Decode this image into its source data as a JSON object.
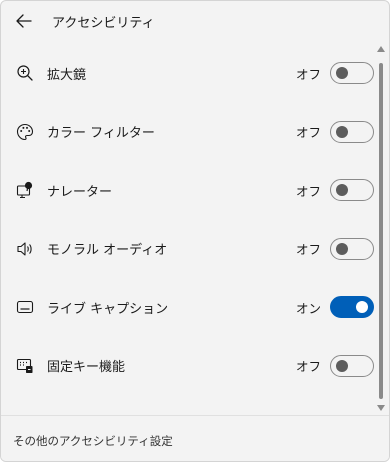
{
  "header": {
    "title": "アクセシビリティ",
    "back_icon": "arrow-left-icon"
  },
  "items": [
    {
      "label": "拡大鏡",
      "state": "オフ",
      "on": false,
      "icon": "magnifier-icon"
    },
    {
      "label": "カラー フィルター",
      "state": "オフ",
      "on": false,
      "icon": "palette-icon"
    },
    {
      "label": "ナレーター",
      "state": "オフ",
      "on": false,
      "icon": "narrator-icon"
    },
    {
      "label": "モノラル オーディオ",
      "state": "オフ",
      "on": false,
      "icon": "speaker-icon"
    },
    {
      "label": "ライブ キャプション",
      "state": "オン",
      "on": true,
      "icon": "captions-icon"
    },
    {
      "label": "固定キー機能",
      "state": "オフ",
      "on": false,
      "icon": "keyboard-icon"
    }
  ],
  "footer": {
    "link": "その他のアクセシビリティ設定"
  },
  "colors": {
    "accent": "#005fb8",
    "panel_bg": "#f3f3f3"
  }
}
